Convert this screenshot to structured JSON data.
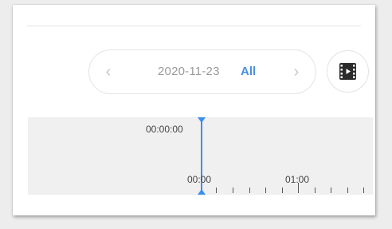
{
  "date_selector": {
    "prev_icon": "chevron-left-icon",
    "date": "2020-11-23",
    "filter": "All",
    "next_icon": "chevron-right-icon"
  },
  "video_button": {
    "icon": "film-icon"
  },
  "timeline": {
    "current_time": "00:00:00",
    "tick_labels": [
      "00:00",
      "01:00"
    ],
    "accent_color": "#3a8ff0"
  },
  "colors": {
    "accent": "#4a90e2",
    "timeline_bg": "#f0f0f0"
  }
}
